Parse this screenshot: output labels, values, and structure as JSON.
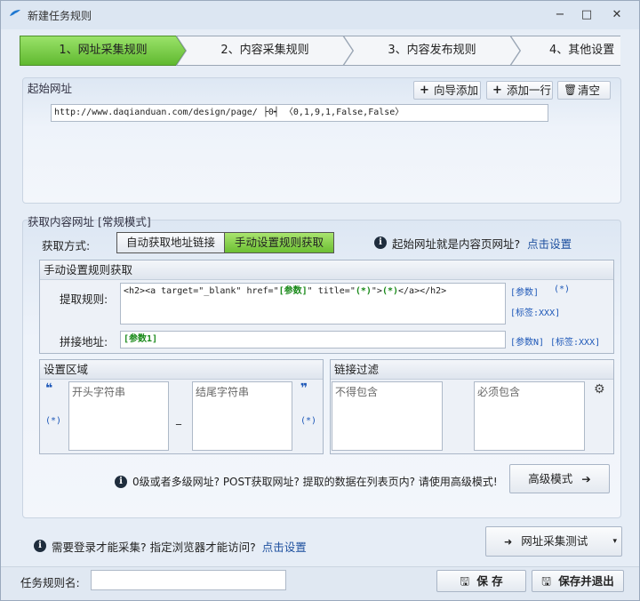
{
  "window": {
    "title": "新建任务规则",
    "minimize": "−",
    "maximize": "□",
    "close": "✕"
  },
  "steps": [
    {
      "label": "1、网址采集规则",
      "active": true
    },
    {
      "label": "2、内容采集规则",
      "active": false
    },
    {
      "label": "3、内容发布规则",
      "active": false
    },
    {
      "label": "4、其他设置",
      "active": false
    }
  ],
  "start_url": {
    "label": "起始网址",
    "wizard_add": "向导添加",
    "add_row": "添加一行",
    "clear": "清空",
    "value_prefix": "http://www.daqianduan.com/design/page/",
    "value_marker": "├0┥",
    "value_suffix": "〈0,1,9,1,False,False〉"
  },
  "fetch": {
    "label": "获取内容网址 [常规模式]",
    "method_label": "获取方式:",
    "auto_option": "自动获取地址链接",
    "manual_option": "手动设置规则获取",
    "question": "起始网址就是内容页网址?",
    "question_link": "点击设置"
  },
  "manual": {
    "heading": "手动设置规则获取",
    "extract_label": "提取规则:",
    "extract_p1": "<h2><a target=\"_blank\" href=\"",
    "extract_p2": "[参数]",
    "extract_p3": "\" title=\"",
    "extract_p4": "(*)",
    "extract_p5": "\">",
    "extract_p6": "(*)",
    "extract_p7": "</a></h2>",
    "param_tag": "[参数]",
    "wildcard_tag": "(*)",
    "label_tag": "[标签:XXX]",
    "join_label": "拼接地址:",
    "join_value": "[参数1]",
    "param_n_tag": "[参数N]",
    "label_tag2": "[标签:XXX]"
  },
  "region": {
    "heading": "设置区域",
    "open_quote": "❝",
    "close_quote": "❞",
    "wildcard_left": "(*)",
    "wildcard_right": "(*)",
    "start_placeholder": "开头字符串",
    "end_placeholder": "结尾字符串",
    "dash": "_"
  },
  "filter": {
    "heading": "链接过滤",
    "exclude_placeholder": "不得包含",
    "include_placeholder": "必须包含",
    "gear": "⚙"
  },
  "advanced": {
    "hint": "0级或者多级网址? POST获取网址? 提取的数据在列表页内? 请使用高级模式!",
    "button": "高级模式"
  },
  "footer": {
    "login_hint": "需要登录才能采集? 指定浏览器才能访问?",
    "login_link": "点击设置",
    "test_button": "网址采集测试",
    "name_label": "任务规则名:",
    "name_value": "",
    "save": "保 存",
    "save_exit": "保存并退出"
  }
}
